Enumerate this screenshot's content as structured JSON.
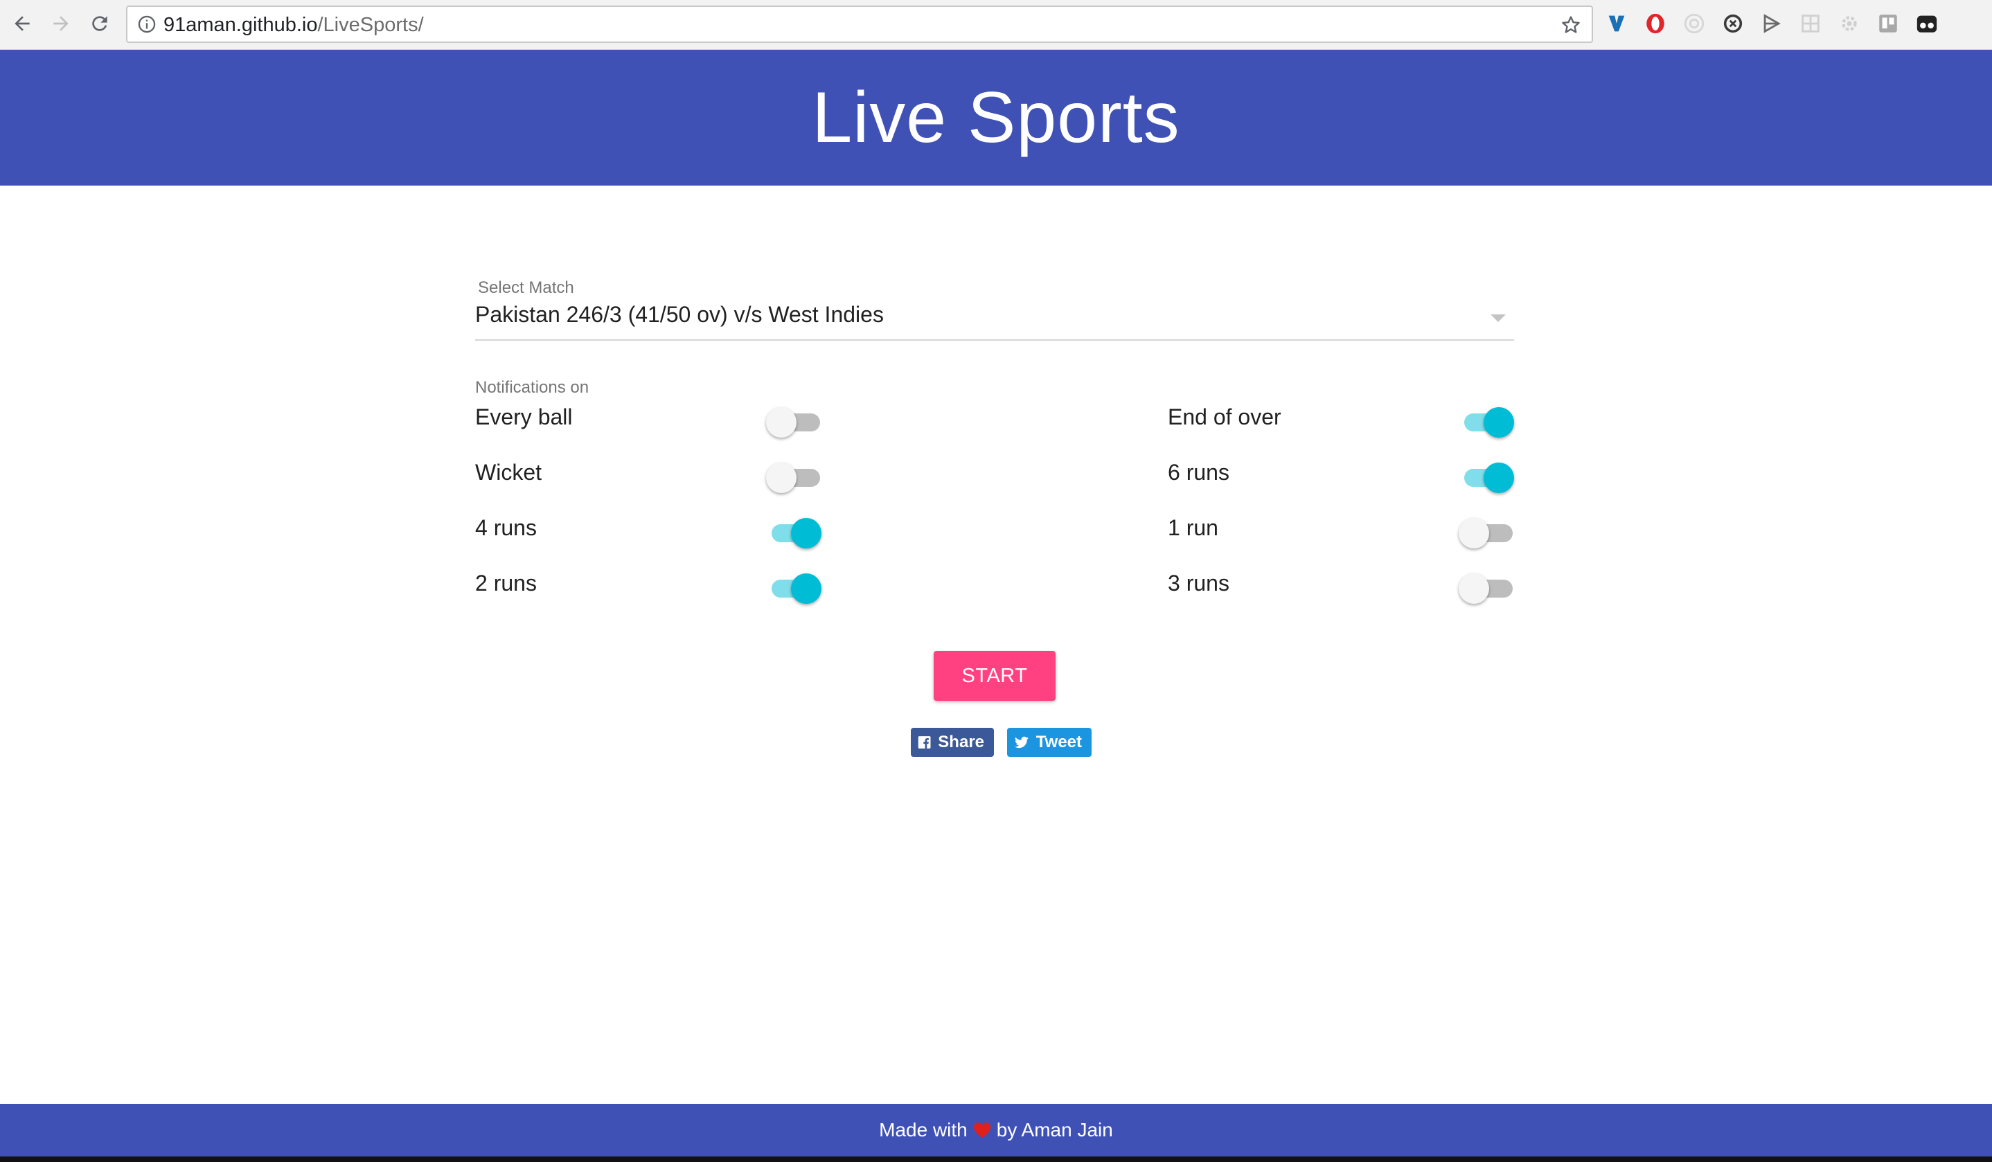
{
  "browser": {
    "url_host": "91aman.github.io",
    "url_path": "/LiveSports/",
    "extensions": [
      "vimium-icon",
      "opera-icon",
      "target-icon",
      "sync-icon",
      "bolt-icon",
      "grid-icon",
      "gear-icon",
      "trello-icon",
      "glasses-icon"
    ]
  },
  "header": {
    "title": "Live Sports"
  },
  "form": {
    "select_label": "Select Match",
    "selected_match": "Pakistan 246/3 (41/50 ov) v/s West Indies",
    "notifications_label": "Notifications on",
    "toggles": [
      {
        "label": "Every ball",
        "on": false
      },
      {
        "label": "End of over",
        "on": true
      },
      {
        "label": "Wicket",
        "on": false
      },
      {
        "label": "6 runs",
        "on": true
      },
      {
        "label": "4 runs",
        "on": true
      },
      {
        "label": "1 run",
        "on": false
      },
      {
        "label": "2 runs",
        "on": true
      },
      {
        "label": "3 runs",
        "on": false
      }
    ],
    "start_label": "START"
  },
  "social": {
    "share_label": "Share",
    "tweet_label": "Tweet"
  },
  "footer": {
    "made_with": "Made with",
    "by": "by Aman Jain"
  },
  "colors": {
    "primary": "#3f51b5",
    "accent": "#ff4081",
    "toggle_on": "#00bcd4",
    "facebook": "#3b5998",
    "twitter": "#1b95e0"
  }
}
